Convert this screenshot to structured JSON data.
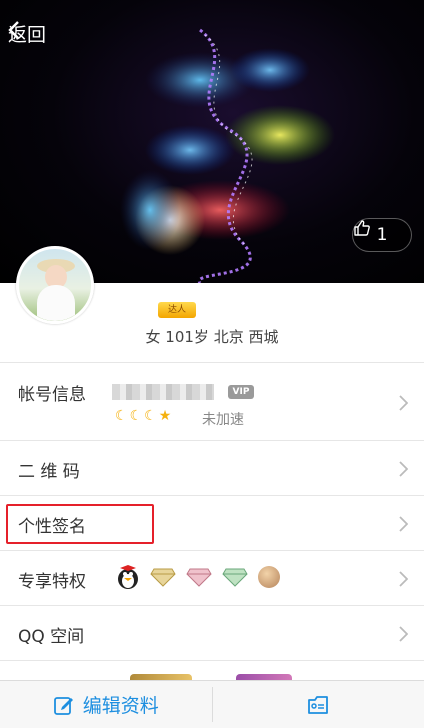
{
  "header": {
    "back_label": "返回",
    "like_count": "1"
  },
  "profile": {
    "badge_text": "达人",
    "info": "女 101岁 北京 西城"
  },
  "rows": {
    "account": {
      "label": "帐号信息",
      "vip_tag": "VIP",
      "speed_text": "未加速"
    },
    "qr": {
      "label": "二 维 码"
    },
    "sign": {
      "label": "个性签名"
    },
    "privilege": {
      "label": "专享特权"
    },
    "qzone": {
      "label": "QQ 空间"
    }
  },
  "bottom_bar": {
    "edit_label": "编辑资料"
  },
  "colors": {
    "accent": "#1e8fe0",
    "highlight": "#e5202a"
  }
}
